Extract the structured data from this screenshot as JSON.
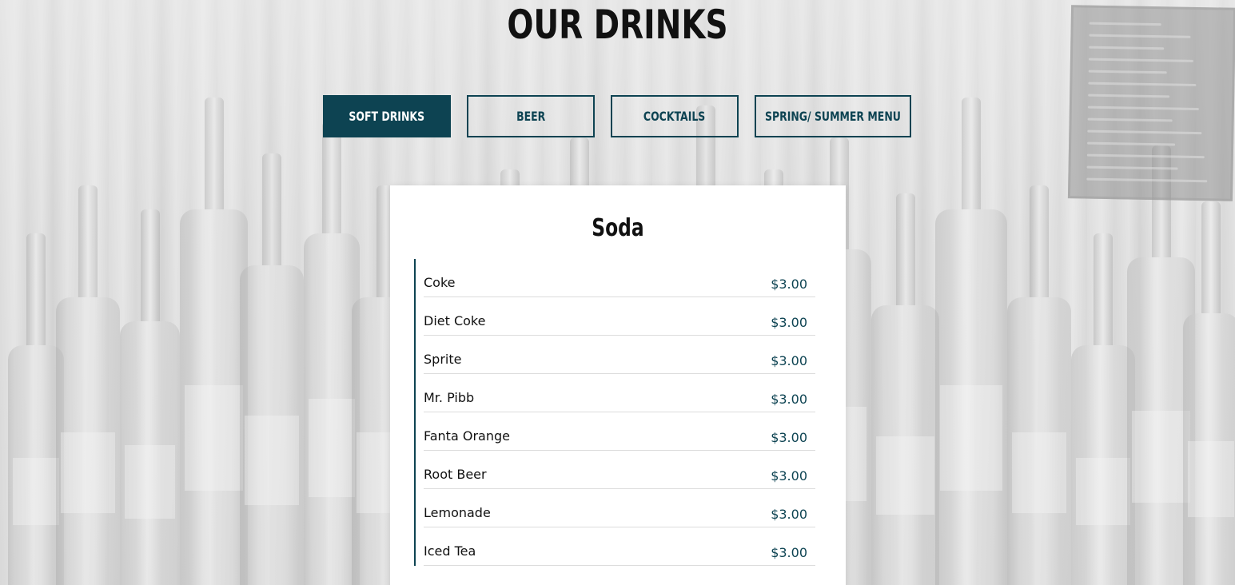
{
  "page": {
    "title": "OUR DRINKS"
  },
  "tabs": [
    {
      "label": "SOFT DRINKS",
      "active": true
    },
    {
      "label": "BEER",
      "active": false
    },
    {
      "label": "COCKTAILS",
      "active": false
    },
    {
      "label": "SPRING/ SUMMER MENU",
      "active": false
    }
  ],
  "section": {
    "title": "Soda",
    "items": [
      {
        "name": "Coke",
        "price": "$3.00"
      },
      {
        "name": "Diet Coke",
        "price": "$3.00"
      },
      {
        "name": "Sprite",
        "price": "$3.00"
      },
      {
        "name": "Mr. Pibb",
        "price": "$3.00"
      },
      {
        "name": "Fanta Orange",
        "price": "$3.00"
      },
      {
        "name": "Root Beer",
        "price": "$3.00"
      },
      {
        "name": "Lemonade",
        "price": "$3.00"
      },
      {
        "name": "Iced Tea",
        "price": "$3.00"
      }
    ]
  },
  "colors": {
    "accent": "#0d4352",
    "background": "#d9d9d9",
    "card": "#ffffff"
  }
}
